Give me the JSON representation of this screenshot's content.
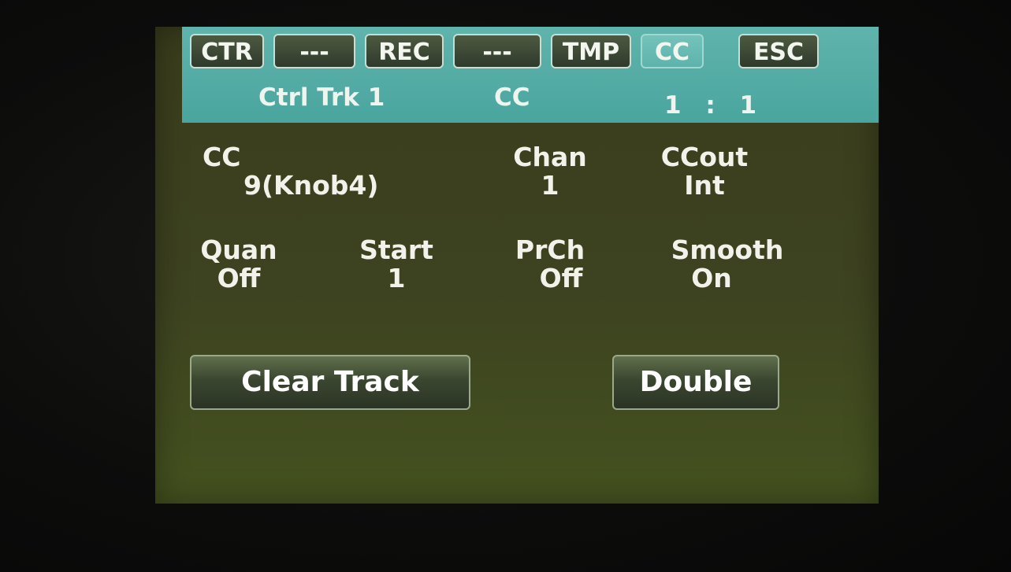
{
  "tabs": [
    {
      "label": "CTR",
      "active": false
    },
    {
      "label": "---",
      "active": false
    },
    {
      "label": "REC",
      "active": false
    },
    {
      "label": "---",
      "active": false
    },
    {
      "label": "TMP",
      "active": false
    },
    {
      "label": "CC",
      "active": true
    },
    {
      "label": "ESC",
      "active": false
    }
  ],
  "header": {
    "track": "Ctrl Trk 1",
    "page": "CC",
    "position": "1 : 1"
  },
  "params": {
    "cc": {
      "label": "CC",
      "value": "9(Knob4)"
    },
    "chan": {
      "label": "Chan",
      "value": "1"
    },
    "ccout": {
      "label": "CCout",
      "value": "Int"
    },
    "quan": {
      "label": "Quan",
      "value": "Off"
    },
    "start": {
      "label": "Start",
      "value": "1"
    },
    "prch": {
      "label": "PrCh",
      "value": "Off"
    },
    "smooth": {
      "label": "Smooth",
      "value": "On"
    }
  },
  "buttons": {
    "clear_track": "Clear Track",
    "double": "Double"
  },
  "colors": {
    "header_bg": "#4aa59f",
    "screen_bg": "#3d4220",
    "active_tab": "#5db3ab"
  }
}
